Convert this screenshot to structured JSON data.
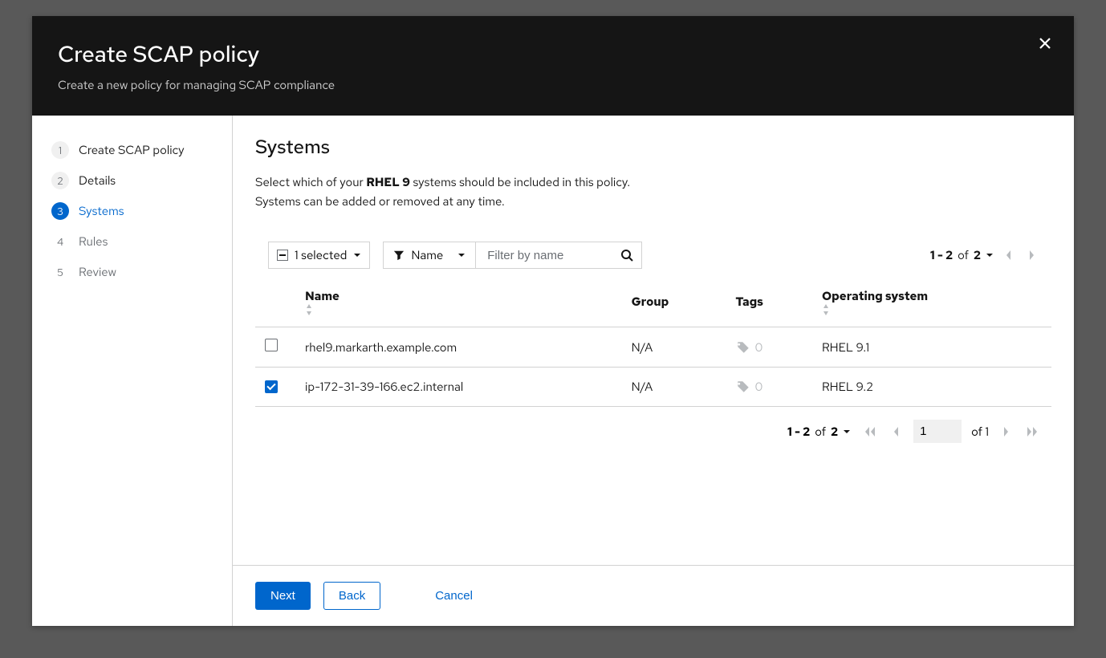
{
  "header": {
    "title": "Create SCAP policy",
    "subtitle": "Create a new policy for managing SCAP compliance"
  },
  "wizard": {
    "steps": [
      {
        "num": "1",
        "label": "Create SCAP policy"
      },
      {
        "num": "2",
        "label": "Details"
      },
      {
        "num": "3",
        "label": "Systems"
      },
      {
        "num": "4",
        "label": "Rules"
      },
      {
        "num": "5",
        "label": "Review"
      }
    ]
  },
  "page": {
    "title": "Systems",
    "desc_pre": "Select which of your ",
    "desc_bold": "RHEL 9",
    "desc_post": " systems should be included in this policy.",
    "desc_line2": "Systems can be added or removed at any time."
  },
  "toolbar": {
    "selected_label": "1 selected",
    "filter_attr": "Name",
    "filter_placeholder": "Filter by name",
    "pag_range": "1 - 2",
    "pag_of": "of",
    "pag_total": "2"
  },
  "table": {
    "headers": {
      "name": "Name",
      "group": "Group",
      "tags": "Tags",
      "os": "Operating system"
    },
    "rows": [
      {
        "checked": false,
        "name": "rhel9.markarth.example.com",
        "group": "N/A",
        "tags": "0",
        "os": "RHEL 9.1"
      },
      {
        "checked": true,
        "name": "ip-172-31-39-166.ec2.internal",
        "group": "N/A",
        "tags": "0",
        "os": "RHEL 9.2"
      }
    ]
  },
  "pagination": {
    "range": "1 - 2",
    "of": "of",
    "total": "2",
    "page_value": "1",
    "page_of": "of 1"
  },
  "footer": {
    "next": "Next",
    "back": "Back",
    "cancel": "Cancel"
  }
}
